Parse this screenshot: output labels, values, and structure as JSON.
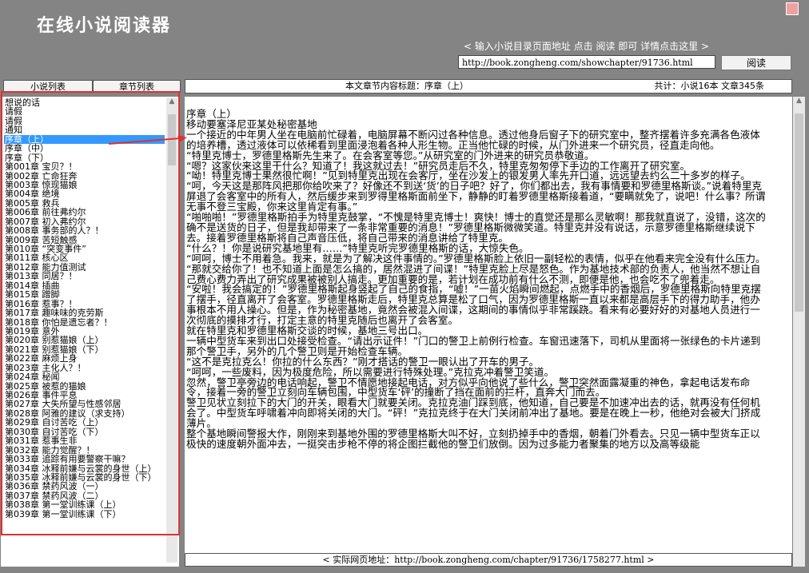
{
  "app": {
    "title": "在线小说阅读器",
    "hint": "< 输入小说目录页面地址 点击 阅读 即可 详情点击这里 >",
    "url_value": "http://book.zongheng.com/showchapter/91736.html",
    "read_button": "阅读"
  },
  "tabs": {
    "novel_list": "小说列表",
    "chapter_list": "章节列表"
  },
  "info": {
    "title": "本文章节内容标题：序章（上）",
    "stats": "共计：小说16本  文章345条"
  },
  "chapters": [
    "想说的话",
    "请假",
    "请假",
    "通知",
    "序章（上）",
    "序章（中）",
    "序章（下）",
    "第001章  宝贝？！",
    "第002章  亡命狂奔",
    "第003章  惊现猫娘",
    "第004章  绝境",
    "第005章  救兵",
    "第006章  前往弗约尔",
    "第007章  初入弗约尔",
    "第008章  事务部的人？！",
    "第009章  苦短触感",
    "第010章  “突变事件”",
    "第011章  核心区",
    "第012章  能力值测试",
    "第013章  同居？！",
    "第014章  插曲",
    "第015章  蹭脚",
    "第016章  惹事？！",
    "第017章  趣味味的克劳斯",
    "第018章  你怕是遗忘者？！",
    "第019章  意外",
    "第020章  别惹猫娘（上）",
    "第021章  别惹猫娘（下）",
    "第022章  麻烦上身",
    "第023章  主化人？！",
    "第024章  秘闻",
    "第025章  被惹的猫娘",
    "第026章  事件平息",
    "第027章  大失所望与性感邻居",
    "第028章  阿雅的建议（求支持）",
    "第029章  自讨苦吃（上）",
    "第030章  自讨苦吃（下）",
    "第031章  惹事生非",
    "第032章  能力觉醒？！",
    "第033章  追踪有用要警察干嘛？",
    "第034章  冰释前嫌与云裳的身世（上）",
    "第035章  冰释前嫌与云裳的身世（下）",
    "第036章  禁药风波（一）",
    "第037章  禁药风波（二）",
    "第038章  第一堂训练课（上）",
    "第039章  第一堂训练课（下）"
  ],
  "selected_chapter_index": 4,
  "content": [
    "序章（上）",
    "移动要塞泽尼亚某处秘密基地",
    "一个接近的中年男人坐在电脑前忙碌着，电脑屏幕不断闪过各种信息。透过他身后窗子下的研究室中，整齐摆着许多充满各色液体的培养槽，透过液体可以依稀看到里面浸泡着各种人形生物。正当他忙碌的时候，从门外进来一个研究员，径直走向他。",
    "“特里克博士，罗德里格斯先生来了。在会客室等您。”从研究室的门外进来的研究员恭敬道。",
    "“嗯？这家伙来这里干什么？知道了！我这就过去！”研究员走后不久，特里克匆匆停下手边的工作离开了研究室。",
    "“呦！特里克博士果然很忙啊！”见到特里克出现在会客厅，坐在沙发上的银发男人率先开口道，远远望去约么二十多岁的样子。",
    "“呵，今天这是那阵风把那你给吹来了？好像还不到送‘货’的日子吧？好了，你们都出去，我有事情要和罗德里格斯谈。”说着特里克屏退了会客室中的所有人，然后缓步来到罗得里格斯面前坐下，静静的盯着罗德里格斯接着道，“要瞒就免了，说吧！什么事？所谓无事不登三宝殿，你来这里肯定有事。”",
    "“啪啪啪！”罗德里格斯拍手为特里克鼓掌，“不愧是特里克博士！爽快！博士的直觉还是那么灵敏啊！那我就直说了，没错，这次的确不是送货的日子，但是我却带来了一条非常重要的消息！”罗德里格斯微微笑道。特里克并没有说话，示意罗德里格斯继续说下去。接着罗德里格斯将自己声音压低，将自己带来的消息讲给了特里克。",
    "“什么？！你是说研究基地里有……”特里克听完罗德里格斯的话，大惊失色。",
    "“呵呵，博士不用着急。我来，就是为了解决这件事情的。”罗德里格斯脸上依旧一副轻松的表情，似乎在他看来完全没有什么压力。",
    "“那就交给你了！也不知道上面是怎么搞的，居然混进了间谍！”特里克脸上尽是怒色。作为基地技术部的负责人，他当然不想让自己费心费力弄出了研究成果被被别人搞走。更加重要的是，若计划在成功前有什么不测，即便是他，也会吃不了兜着走。",
    "“安啦！我会搞定的！”罗德里格斯起身竖起了自己的食指，“嘘！”一苗火焰瞬间燃起，点燃手中的香烟后，罗德里格斯向特里克摆了摆手，径直离开了会客室。罗德里格斯走后，特里克总算是松了口气，因为罗德里格斯一直以来都是高层手下的得力助手，他办事根本不用人操心。但是，作为秘密基地，竟然会被混入间谍，这期间的事情似乎非常蹊跷。看来有必要好好的对基地人员进行一次彻底的摸排才行，打定主意的特里克随后也离开了会客室。",
    "就在特里克和罗德里格斯交谈的时候，基地三号出口。",
    "一辆中型货车来到出口处接受检查。“请出示证件！”门口的警卫上前例行检查。车窗迅速落下，司机从里面将一张绿色的卡片递到那个警卫手，另外的几个警卫则是开始检查车辆。",
    "“这不是克拉克么！你拉的什么东西？”刚才搭话的警卫一眼认出了开车的男子。",
    "“呵呵，一些废料，因为极度危险，所以需要进行特殊处理。”克拉克冲着警卫笑道。",
    "忽然，警卫亭旁边的电话响起，警卫不情愿地接起电话，对方似乎向他说了些什么，警卫突然面露凝重的神色，拿起电话发布命令，接着一旁的警卫立刻向车辆包围，中型货车‘砰’的撞断了挡在面前的拦杆，直奔大门而去。",
    "警卫见状立刻拉下的大门的开关，眼看大门就要关闭。克拉克油门踩到底，他知道，自己要是不加速冲出去的话，就再没有任何机会了。中型货车呼啸着冲向即将关闭的大门。“砰！”克拉克终于在大门关闭前冲出了基地。要是在晚上一秒，他绝对会被大门挤成薄片。",
    "整个基地瞬间警报大作，刚刚来到基地外围的罗德里格斯大叫不好，立刻扔掉手中的香烟，朝着门外看去。只见一辆中型货车正以极快的速度朝外面冲去，一挺突击步枪不停的将企图拦截他的警卫们放倒。因为过多能力者聚集的地方以及高等级能"
  ],
  "bottom_url": "< 实际网页地址：http://book.zongheng.com/chapter/91736/1758277.html >"
}
